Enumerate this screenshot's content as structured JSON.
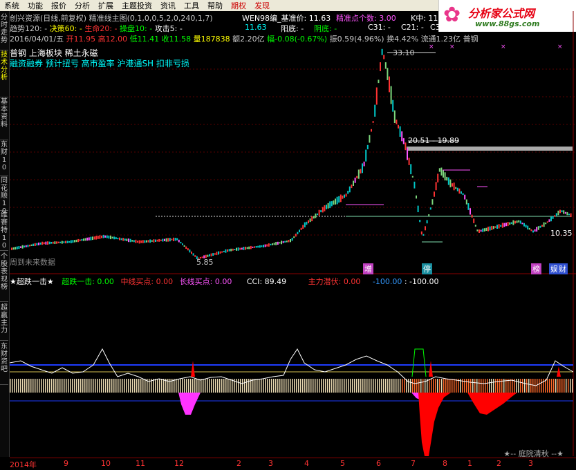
{
  "menu": [
    "系统",
    "功能",
    "报价",
    "分析",
    "扩展",
    "主题投资",
    "资讯",
    "工具",
    "帮助",
    "期权",
    "发现"
  ],
  "logo": {
    "title": "分析家公式网",
    "url": "www.88gs.com"
  },
  "sidetabs": [
    "分时走势",
    "技术分析",
    "基本资料",
    "东财10",
    "同花顺10",
    "维赛特10",
    "个股表现榜",
    "超赢主力",
    "东财资吧"
  ],
  "header": {
    "title": "创兴资源(日线,前复权) 精准线主图(0,1,0,0,5,2,0,240,1,7)",
    "wen": "WEN98编_基准价: 11.63",
    "jz": "精准点个数: 3.00",
    "k": "K中: 11",
    "line2": {
      "qushi": "趋势120: -",
      "jueci": "决策60: -",
      "shengming": "生命20: -",
      "caopan": "操盘10: -",
      "gongji": "攻击5: -",
      "v1": "11.63",
      "yangdi": "阳底: -",
      "yindi": "阴底: -",
      "c31": "C31: -",
      "c21": "C21: -",
      "c32": "C32: -"
    },
    "line3": {
      "date": "2016/04/01/五",
      "open": "开11.95",
      "high": "高12.00",
      "low": "低11.41",
      "close": "收11.58",
      "vol": "量187838",
      "amt": "额2.20亿",
      "chg": "幅-0.08(-0.67%)",
      "amp": "振0.59(4.96%)",
      "turn": "换4.42%",
      "float": "流通1.23亿",
      "cat": "普钢"
    },
    "stock_line1": "普钢      上海板块 稀土永磁",
    "stock_line2": "融资融券 预计扭亏 高市盈率 沪港通SH 扣非亏损"
  },
  "annotations": {
    "peak": "33.10",
    "mid": "20.51 - 19.89",
    "low": "5.85",
    "right": "10.35",
    "future": "周到未来数据",
    "tag1": "增",
    "tag2": "停",
    "tag3": "榜",
    "tag4": "娱",
    "tag5": "财"
  },
  "indicator": {
    "name": "★超跌一击★",
    "l1": "超跌一击: 0.00",
    "l2": "中线买点: 0.00",
    "l3": "长线买点: 0.00",
    "cci": "CCI: 89.49",
    "l4": "主力潜伏: 0.00",
    "l5": "-100.00",
    "l6": ": -100.00"
  },
  "axis": [
    "2014年",
    "9",
    "10",
    "11",
    "12",
    "2",
    "3",
    "4",
    "5",
    "6",
    "7",
    "8",
    "1",
    "2",
    "3"
  ],
  "footer": "★-- 庭院清秋 --★"
}
